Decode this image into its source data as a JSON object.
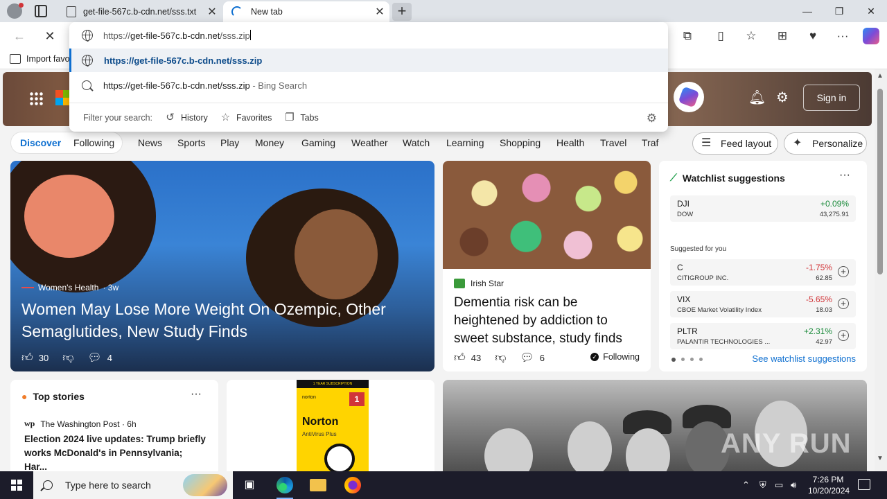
{
  "tabs": [
    {
      "title": "get-file-567c.b-cdn.net/sss.txt"
    },
    {
      "title": "New tab"
    }
  ],
  "window": {
    "minimize": "—",
    "maximize": "❐",
    "close": "✕",
    "new_tab": "+"
  },
  "favorites_bar": {
    "import_label": "Import favo"
  },
  "omnibox": {
    "typed_prefix": "https://",
    "typed_host": "get-file-567c.b-cdn.net",
    "typed_path": "/sss.zip",
    "suggestion_url": "https://get-file-567c.b-cdn.net/sss.zip",
    "search_query": "https://get-file-567c.b-cdn.net/sss.zip",
    "search_engine_suffix": " - Bing Search",
    "filter_label": "Filter your search:",
    "filters": [
      "History",
      "Favorites",
      "Tabs"
    ]
  },
  "header": {
    "sign_in": "Sign in"
  },
  "feed_nav": {
    "discover": "Discover",
    "following": "Following",
    "categories": [
      "News",
      "Sports",
      "Play",
      "Money",
      "Gaming",
      "Weather",
      "Watch",
      "Learning",
      "Shopping",
      "Health",
      "Travel",
      "Traf"
    ],
    "feed_layout": "Feed layout",
    "personalize": "Personalize"
  },
  "main_story": {
    "source": "Women's Health",
    "age": " · 3w",
    "headline": "Women May Lose More Weight On Ozempic, Other Semaglutides, New Study Finds",
    "likes": "30",
    "comments": "4"
  },
  "second_story": {
    "source": "Irish Star",
    "headline": "Dementia risk can be heightened by addiction to sweet substance, study finds",
    "likes": "43",
    "comments": "6",
    "following": "Following"
  },
  "watchlist": {
    "title": "Watchlist suggestions",
    "more": "···",
    "items": [
      {
        "symbol": "DJI",
        "name": "DOW",
        "change": "+0.09%",
        "price": "43,275.91",
        "direction": "up"
      }
    ],
    "suggested_label": "Suggested for you",
    "suggested": [
      {
        "symbol": "C",
        "name": "CITIGROUP INC.",
        "change": "-1.75%",
        "price": "62.85",
        "direction": "down"
      },
      {
        "symbol": "VIX",
        "name": "CBOE Market Volatility Index",
        "change": "-5.65%",
        "price": "18.03",
        "direction": "down"
      },
      {
        "symbol": "PLTR",
        "name": "PALANTIR TECHNOLOGIES ...",
        "change": "+2.31%",
        "price": "42.97",
        "direction": "up"
      }
    ],
    "see_all": "See watchlist suggestions"
  },
  "top_stories": {
    "title": "Top stories",
    "more": "···",
    "source_logo": "wp",
    "source": "The Washington Post · 6h",
    "headline": "Election 2024 live updates: Trump briefly works McDonald's in Pennsylvania; Har..."
  },
  "ad": {
    "band": "1 YEAR SUBSCRIPTION",
    "brand_small": "norton",
    "brand": "Norton",
    "product": "AntiVirus Plus",
    "badge": "1"
  },
  "watermark": "ANY RUN",
  "taskbar": {
    "search_placeholder": "Type here to search",
    "time": "7:26 PM",
    "date": "10/20/2024"
  },
  "colors": {
    "accent": "#0e6fd0",
    "positive": "#1a8a3a",
    "negative": "#d13438"
  }
}
